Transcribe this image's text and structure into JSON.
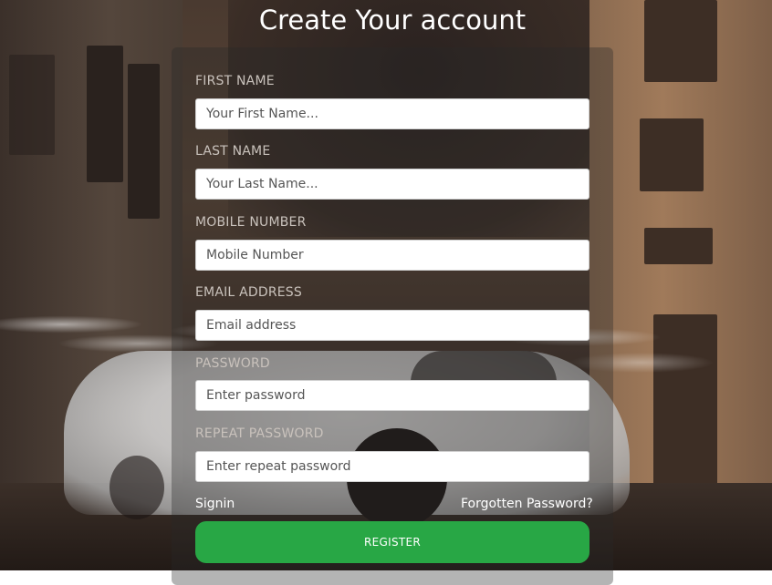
{
  "title": "Create Your account",
  "fields": [
    {
      "label": "FIRST NAME",
      "placeholder": "Your First Name...",
      "value": ""
    },
    {
      "label": "LAST NAME",
      "placeholder": "Your Last Name...",
      "value": ""
    },
    {
      "label": "MOBILE NUMBER",
      "placeholder": "Mobile Number",
      "value": ""
    },
    {
      "label": "EMAIL ADDRESS",
      "placeholder": "Email address",
      "value": ""
    },
    {
      "label": "PASSWORD",
      "placeholder": "Enter password",
      "value": ""
    },
    {
      "label": "REPEAT PASSWORD",
      "placeholder": "Enter repeat password",
      "value": ""
    }
  ],
  "links": {
    "signin": "Signin",
    "forgot": "Forgotten Password?"
  },
  "register_label": "REGISTER",
  "colors": {
    "accent": "#28a745",
    "title": "#ffffff",
    "label": "#c9c2bc"
  }
}
